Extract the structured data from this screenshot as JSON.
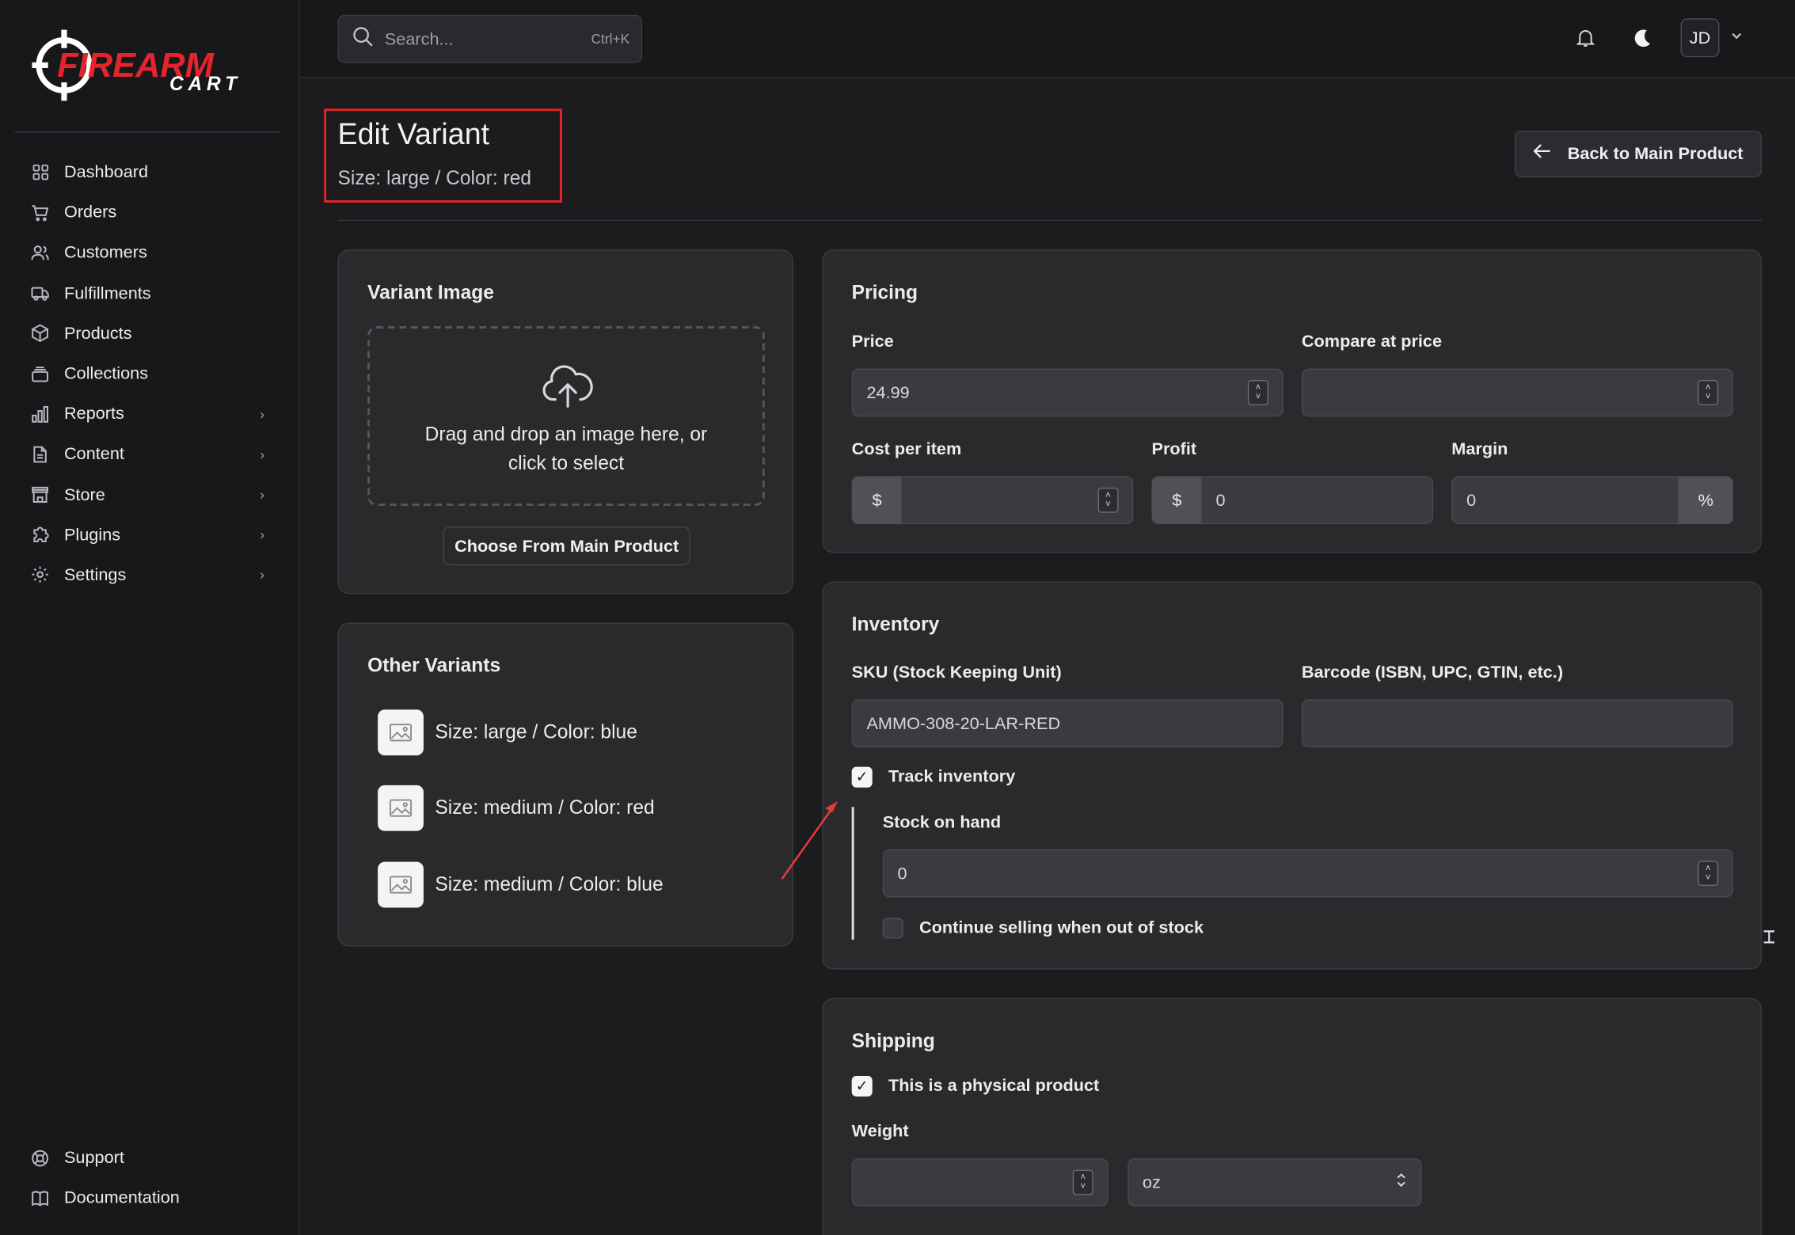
{
  "brand": {
    "logo_word": "FIREARM",
    "logo_sub": "CART",
    "accent": "#e5252b"
  },
  "sidebar": {
    "items": [
      {
        "label": "Dashboard",
        "icon": "grid-icon",
        "chevron": false
      },
      {
        "label": "Orders",
        "icon": "cart-icon",
        "chevron": false
      },
      {
        "label": "Customers",
        "icon": "users-icon",
        "chevron": false
      },
      {
        "label": "Fulfillments",
        "icon": "truck-icon",
        "chevron": false
      },
      {
        "label": "Products",
        "icon": "box-icon",
        "chevron": false
      },
      {
        "label": "Collections",
        "icon": "layers-icon",
        "chevron": false
      },
      {
        "label": "Reports",
        "icon": "bar-chart-icon",
        "chevron": true
      },
      {
        "label": "Content",
        "icon": "file-icon",
        "chevron": true
      },
      {
        "label": "Store",
        "icon": "store-icon",
        "chevron": true
      },
      {
        "label": "Plugins",
        "icon": "puzzle-icon",
        "chevron": true
      },
      {
        "label": "Settings",
        "icon": "gear-icon",
        "chevron": true
      }
    ],
    "bottom": [
      {
        "label": "Support",
        "icon": "lifebuoy-icon"
      },
      {
        "label": "Documentation",
        "icon": "book-icon"
      }
    ]
  },
  "topbar": {
    "search_placeholder": "Search...",
    "search_shortcut": "Ctrl+K",
    "avatar_initials": "JD"
  },
  "page": {
    "title": "Edit Variant",
    "subtitle": "Size: large / Color: red",
    "back_label": "Back to Main Product"
  },
  "variant_image": {
    "title": "Variant Image",
    "drop_text_line1": "Drag and drop an image here, or",
    "drop_text_line2": "click to select",
    "choose_label": "Choose From Main Product"
  },
  "other_variants": {
    "title": "Other Variants",
    "items": [
      "Size: large / Color: blue",
      "Size: medium / Color: red",
      "Size: medium / Color: blue"
    ]
  },
  "pricing": {
    "title": "Pricing",
    "price_label": "Price",
    "price_value": "24.99",
    "compare_label": "Compare at price",
    "compare_value": "",
    "cost_label": "Cost per item",
    "cost_value": "",
    "profit_label": "Profit",
    "profit_value": "0",
    "margin_label": "Margin",
    "margin_value": "0",
    "currency_symbol": "$",
    "percent_symbol": "%"
  },
  "inventory": {
    "title": "Inventory",
    "sku_label": "SKU (Stock Keeping Unit)",
    "sku_value": "AMMO-308-20-LAR-RED",
    "barcode_label": "Barcode (ISBN, UPC, GTIN, etc.)",
    "barcode_value": "",
    "track_label": "Track inventory",
    "track_checked": true,
    "stock_label": "Stock on hand",
    "stock_value": "0",
    "continue_label": "Continue selling when out of stock",
    "continue_checked": false
  },
  "shipping": {
    "title": "Shipping",
    "physical_label": "This is a physical product",
    "physical_checked": true,
    "weight_label": "Weight",
    "weight_value": "",
    "unit_value": "oz"
  }
}
